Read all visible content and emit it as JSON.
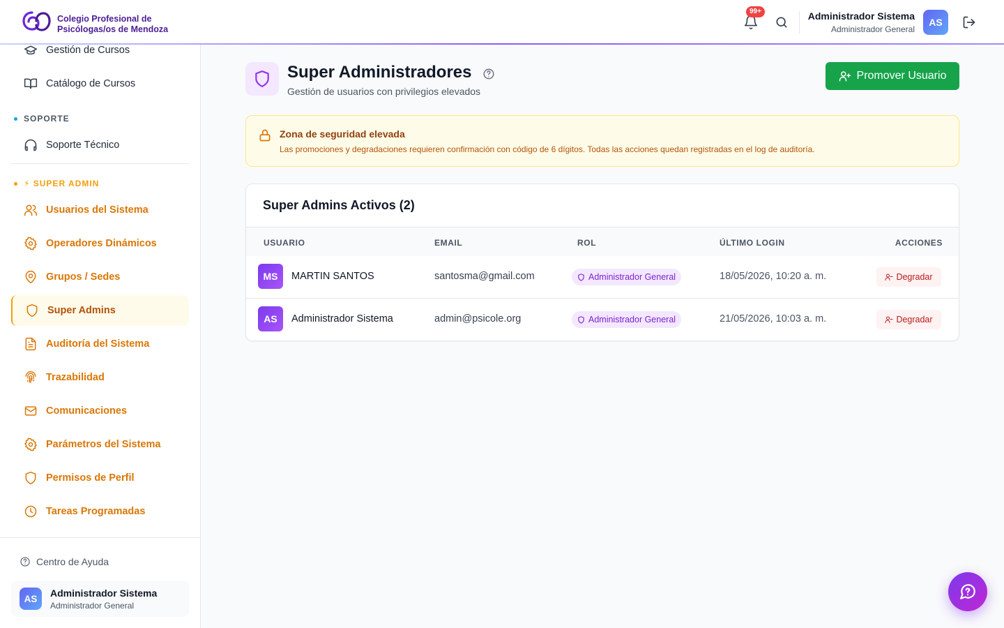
{
  "header": {
    "brand_line1": "Colegio Profesional de",
    "brand_line2": "Psicólogas/os de Mendoza",
    "notifications_badge": "99+",
    "user_name": "Administrador Sistema",
    "user_role": "Administrador General",
    "user_initials": "AS"
  },
  "sidebar": {
    "top_items": [
      {
        "label": "Gestión de Cursos",
        "icon": "graduation-cap-icon"
      },
      {
        "label": "Catálogo de Cursos",
        "icon": "book-open-icon"
      }
    ],
    "section_support": "SOPORTE",
    "support_items": [
      {
        "label": "Soporte Técnico",
        "icon": "headphones-icon"
      }
    ],
    "section_super": "⚡ SUPER ADMIN",
    "super_items": [
      {
        "label": "Usuarios del Sistema",
        "icon": "users-icon"
      },
      {
        "label": "Operadores Dinámicos",
        "icon": "gear-icon"
      },
      {
        "label": "Grupos / Sedes",
        "icon": "map-pin-icon"
      },
      {
        "label": "Super Admins",
        "icon": "shield-icon",
        "active": true
      },
      {
        "label": "Auditoría del Sistema",
        "icon": "file-text-icon"
      },
      {
        "label": "Trazabilidad",
        "icon": "fingerprint-icon"
      },
      {
        "label": "Comunicaciones",
        "icon": "mail-icon"
      },
      {
        "label": "Parámetros del Sistema",
        "icon": "gear-icon"
      },
      {
        "label": "Permisos de Perfil",
        "icon": "shield-icon"
      },
      {
        "label": "Tareas Programadas",
        "icon": "clock-icon"
      }
    ],
    "help_label": "Centro de Ayuda",
    "user_name": "Administrador Sistema",
    "user_role": "Administrador General",
    "user_initials": "AS"
  },
  "page": {
    "title": "Super Administradores",
    "subtitle": "Gestión de usuarios con privilegios elevados",
    "promote_label": "Promover Usuario"
  },
  "alert": {
    "title": "Zona de seguridad elevada",
    "text": "Las promociones y degradaciones requieren confirmación con código de 6 dígitos. Todas las acciones quedan registradas en el log de auditoría."
  },
  "table": {
    "title": "Super Admins Activos (2)",
    "columns": [
      "USUARIO",
      "EMAIL",
      "ROL",
      "ÚLTIMO LOGIN",
      "ACCIONES"
    ],
    "rows": [
      {
        "initials": "MS",
        "name": "MARTIN SANTOS",
        "email": "santosma@gmail.com",
        "role": "Administrador General",
        "last_login": "18/05/2026, 10:20 a. m.",
        "action": "Degradar"
      },
      {
        "initials": "AS",
        "name": "Administrador Sistema",
        "email": "admin@psicole.org",
        "role": "Administrador General",
        "last_login": "21/05/2026, 10:03 a. m.",
        "action": "Degradar"
      }
    ]
  },
  "colors": {
    "accent_purple": "#7c3aed",
    "super_admin_orange": "#d97706",
    "success_green": "#16a34a",
    "danger_red": "#b91c1c"
  }
}
